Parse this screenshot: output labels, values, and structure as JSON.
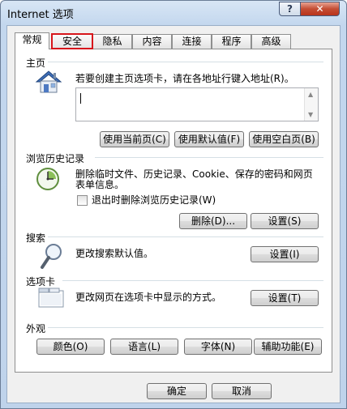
{
  "window": {
    "title": "Internet 选项",
    "help_label": "?",
    "close_label": "✕"
  },
  "tabs": [
    {
      "label": "常规"
    },
    {
      "label": "安全"
    },
    {
      "label": "隐私"
    },
    {
      "label": "内容"
    },
    {
      "label": "连接"
    },
    {
      "label": "程序"
    },
    {
      "label": "高级"
    }
  ],
  "home": {
    "title": "主页",
    "description": "若要创建主页选项卡，请在各地址行键入地址(R)。",
    "value": "",
    "use_current": "使用当前页(C)",
    "use_default": "使用默认值(F)",
    "use_blank": "使用空白页(B)"
  },
  "history": {
    "title": "浏览历史记录",
    "description_line1": "删除临时文件、历史记录、Cookie、保存的密码和网页",
    "description_line2": "表单信息。",
    "checkbox_label": "退出时删除浏览历史记录(W)",
    "delete_button": "删除(D)...",
    "settings_button": "设置(S)"
  },
  "search": {
    "title": "搜索",
    "description": "更改搜索默认值。",
    "settings_button": "设置(I)"
  },
  "tabs_section": {
    "title": "选项卡",
    "description": "更改网页在选项卡中显示的方式。",
    "settings_button": "设置(T)"
  },
  "appearance": {
    "title": "外观",
    "colors": "颜色(O)",
    "languages": "语言(L)",
    "fonts": "字体(N)",
    "accessibility": "辅助功能(E)"
  },
  "footer": {
    "ok": "确定",
    "cancel": "取消"
  },
  "colors": {
    "highlight": "#d7161b",
    "close_button": "#c44d33"
  }
}
